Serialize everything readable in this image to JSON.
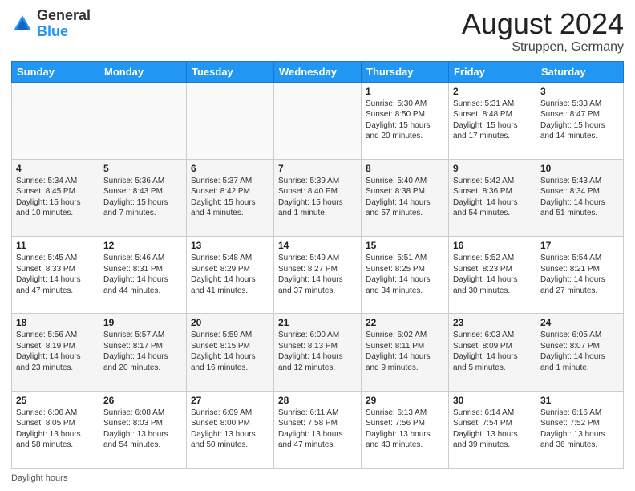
{
  "logo": {
    "general": "General",
    "blue": "Blue"
  },
  "title": {
    "month": "August 2024",
    "location": "Struppen, Germany"
  },
  "days_of_week": [
    "Sunday",
    "Monday",
    "Tuesday",
    "Wednesday",
    "Thursday",
    "Friday",
    "Saturday"
  ],
  "weeks": [
    [
      {
        "day": "",
        "info": ""
      },
      {
        "day": "",
        "info": ""
      },
      {
        "day": "",
        "info": ""
      },
      {
        "day": "",
        "info": ""
      },
      {
        "day": "1",
        "info": "Sunrise: 5:30 AM\nSunset: 8:50 PM\nDaylight: 15 hours and 20 minutes."
      },
      {
        "day": "2",
        "info": "Sunrise: 5:31 AM\nSunset: 8:48 PM\nDaylight: 15 hours and 17 minutes."
      },
      {
        "day": "3",
        "info": "Sunrise: 5:33 AM\nSunset: 8:47 PM\nDaylight: 15 hours and 14 minutes."
      }
    ],
    [
      {
        "day": "4",
        "info": "Sunrise: 5:34 AM\nSunset: 8:45 PM\nDaylight: 15 hours and 10 minutes."
      },
      {
        "day": "5",
        "info": "Sunrise: 5:36 AM\nSunset: 8:43 PM\nDaylight: 15 hours and 7 minutes."
      },
      {
        "day": "6",
        "info": "Sunrise: 5:37 AM\nSunset: 8:42 PM\nDaylight: 15 hours and 4 minutes."
      },
      {
        "day": "7",
        "info": "Sunrise: 5:39 AM\nSunset: 8:40 PM\nDaylight: 15 hours and 1 minute."
      },
      {
        "day": "8",
        "info": "Sunrise: 5:40 AM\nSunset: 8:38 PM\nDaylight: 14 hours and 57 minutes."
      },
      {
        "day": "9",
        "info": "Sunrise: 5:42 AM\nSunset: 8:36 PM\nDaylight: 14 hours and 54 minutes."
      },
      {
        "day": "10",
        "info": "Sunrise: 5:43 AM\nSunset: 8:34 PM\nDaylight: 14 hours and 51 minutes."
      }
    ],
    [
      {
        "day": "11",
        "info": "Sunrise: 5:45 AM\nSunset: 8:33 PM\nDaylight: 14 hours and 47 minutes."
      },
      {
        "day": "12",
        "info": "Sunrise: 5:46 AM\nSunset: 8:31 PM\nDaylight: 14 hours and 44 minutes."
      },
      {
        "day": "13",
        "info": "Sunrise: 5:48 AM\nSunset: 8:29 PM\nDaylight: 14 hours and 41 minutes."
      },
      {
        "day": "14",
        "info": "Sunrise: 5:49 AM\nSunset: 8:27 PM\nDaylight: 14 hours and 37 minutes."
      },
      {
        "day": "15",
        "info": "Sunrise: 5:51 AM\nSunset: 8:25 PM\nDaylight: 14 hours and 34 minutes."
      },
      {
        "day": "16",
        "info": "Sunrise: 5:52 AM\nSunset: 8:23 PM\nDaylight: 14 hours and 30 minutes."
      },
      {
        "day": "17",
        "info": "Sunrise: 5:54 AM\nSunset: 8:21 PM\nDaylight: 14 hours and 27 minutes."
      }
    ],
    [
      {
        "day": "18",
        "info": "Sunrise: 5:56 AM\nSunset: 8:19 PM\nDaylight: 14 hours and 23 minutes."
      },
      {
        "day": "19",
        "info": "Sunrise: 5:57 AM\nSunset: 8:17 PM\nDaylight: 14 hours and 20 minutes."
      },
      {
        "day": "20",
        "info": "Sunrise: 5:59 AM\nSunset: 8:15 PM\nDaylight: 14 hours and 16 minutes."
      },
      {
        "day": "21",
        "info": "Sunrise: 6:00 AM\nSunset: 8:13 PM\nDaylight: 14 hours and 12 minutes."
      },
      {
        "day": "22",
        "info": "Sunrise: 6:02 AM\nSunset: 8:11 PM\nDaylight: 14 hours and 9 minutes."
      },
      {
        "day": "23",
        "info": "Sunrise: 6:03 AM\nSunset: 8:09 PM\nDaylight: 14 hours and 5 minutes."
      },
      {
        "day": "24",
        "info": "Sunrise: 6:05 AM\nSunset: 8:07 PM\nDaylight: 14 hours and 1 minute."
      }
    ],
    [
      {
        "day": "25",
        "info": "Sunrise: 6:06 AM\nSunset: 8:05 PM\nDaylight: 13 hours and 58 minutes."
      },
      {
        "day": "26",
        "info": "Sunrise: 6:08 AM\nSunset: 8:03 PM\nDaylight: 13 hours and 54 minutes."
      },
      {
        "day": "27",
        "info": "Sunrise: 6:09 AM\nSunset: 8:00 PM\nDaylight: 13 hours and 50 minutes."
      },
      {
        "day": "28",
        "info": "Sunrise: 6:11 AM\nSunset: 7:58 PM\nDaylight: 13 hours and 47 minutes."
      },
      {
        "day": "29",
        "info": "Sunrise: 6:13 AM\nSunset: 7:56 PM\nDaylight: 13 hours and 43 minutes."
      },
      {
        "day": "30",
        "info": "Sunrise: 6:14 AM\nSunset: 7:54 PM\nDaylight: 13 hours and 39 minutes."
      },
      {
        "day": "31",
        "info": "Sunrise: 6:16 AM\nSunset: 7:52 PM\nDaylight: 13 hours and 36 minutes."
      }
    ]
  ],
  "footer": {
    "label": "Daylight hours"
  }
}
